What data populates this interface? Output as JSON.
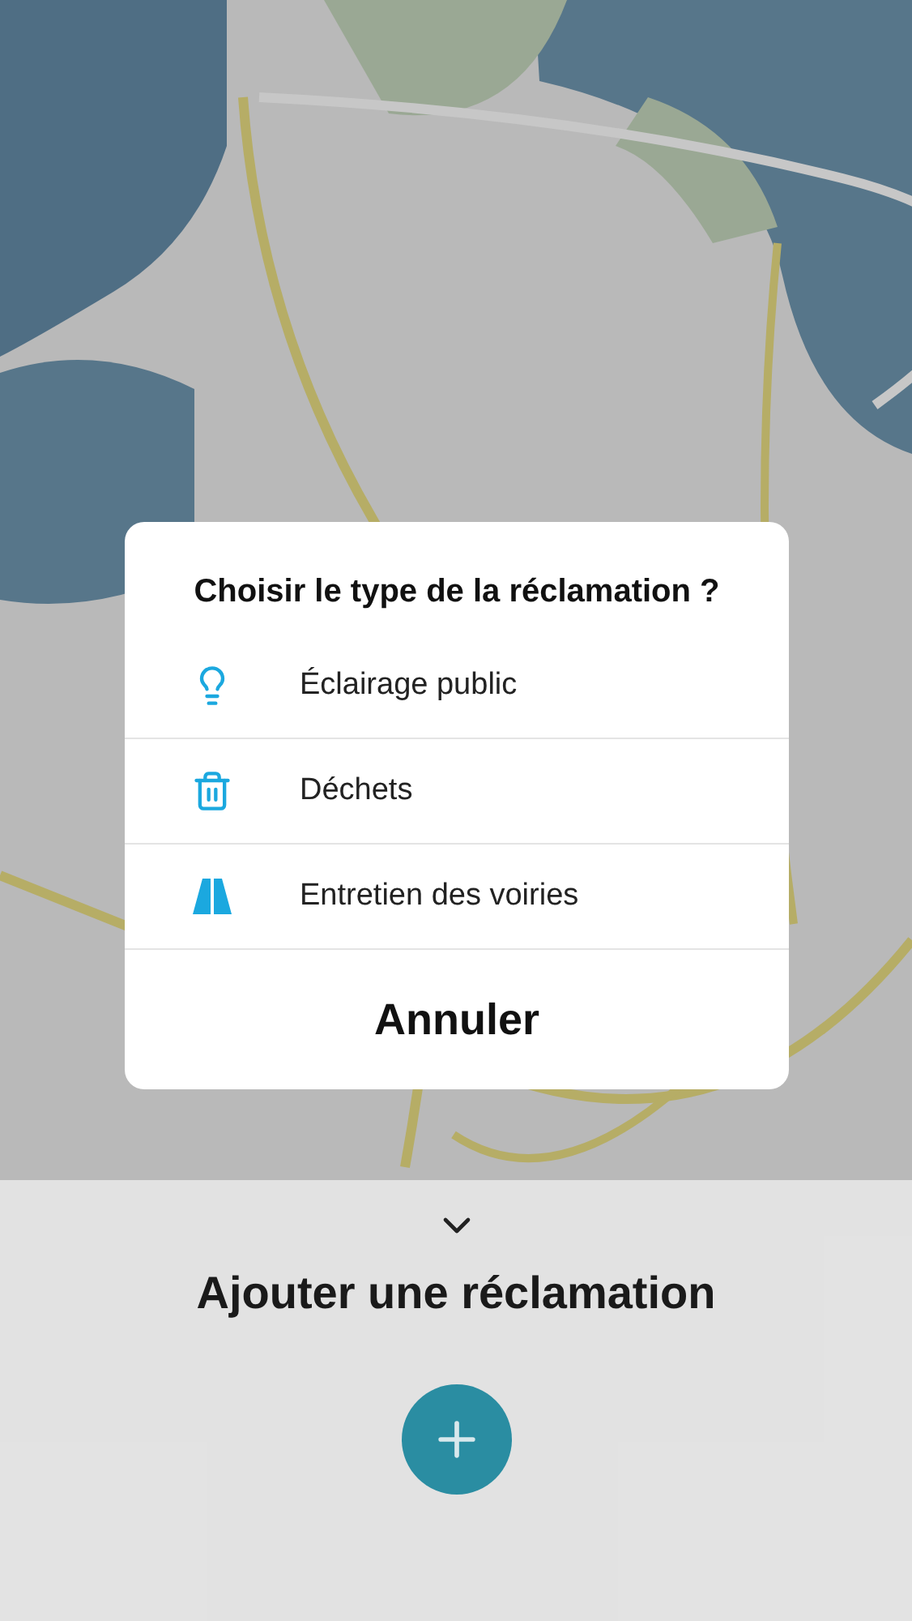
{
  "panel": {
    "title": "Ajouter une réclamation"
  },
  "dialog": {
    "title": "Choisir le type de la réclamation ?",
    "options": [
      {
        "kind": "lamp",
        "label": "Éclairage public"
      },
      {
        "kind": "trash",
        "label": "Déchets"
      },
      {
        "kind": "road",
        "label": "Entretien des voiries"
      }
    ],
    "cancel": "Annuler"
  }
}
